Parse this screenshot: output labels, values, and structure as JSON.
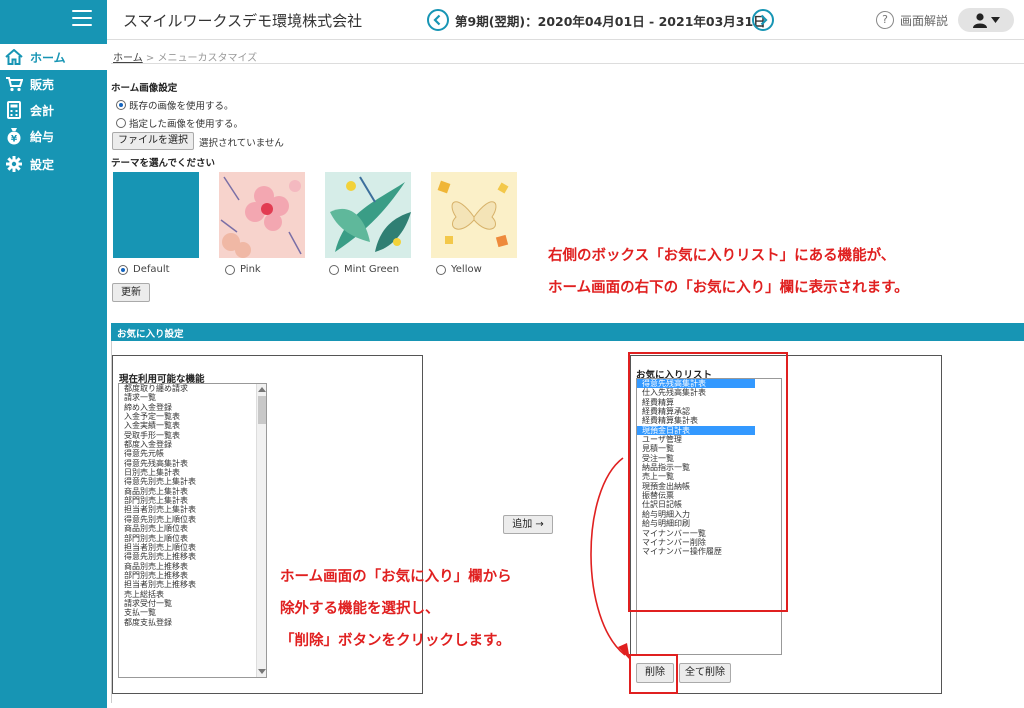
{
  "header": {
    "company": "スマイルワークスデモ環境株式会社",
    "period": "第9期(翌期)：2020年04月01日 - 2021年03月31日",
    "help_label": "画面解説"
  },
  "sidebar": {
    "items": [
      {
        "label": "ホーム",
        "icon": "home-icon"
      },
      {
        "label": "販売",
        "icon": "cart-icon"
      },
      {
        "label": "会計",
        "icon": "calculator-icon"
      },
      {
        "label": "給与",
        "icon": "money-bag-icon"
      },
      {
        "label": "設定",
        "icon": "gear-icon"
      }
    ]
  },
  "breadcrumb": {
    "home": "ホーム",
    "separator": ">",
    "current": "メニューカスタマイズ"
  },
  "home_image": {
    "heading": "ホーム画像設定",
    "option_default": "既存の画像を使用する。",
    "option_custom": "指定した画像を使用する。",
    "file_button": "ファイルを選択",
    "file_status": "選択されていません",
    "theme_heading": "テーマを選んでください",
    "themes": [
      "Default",
      "Pink",
      "Mint Green",
      "Yellow"
    ],
    "update_button": "更新"
  },
  "favorites": {
    "section_title": "お気に入り設定",
    "available_title": "現在利用可能な機能",
    "available_items": [
      "都度取り纏め請求",
      "請求一覧",
      "締め入金登録",
      "入金予定一覧表",
      "入金実績一覧表",
      "受取手形一覧表",
      "都度入金登録",
      "得意先元帳",
      "得意先残高集計表",
      "日別売上集計表",
      "得意先別売上集計表",
      "商品別売上集計表",
      "部門別売上集計表",
      "担当者別売上集計表",
      "得意先別売上順位表",
      "商品別売上順位表",
      "部門別売上順位表",
      "担当者別売上順位表",
      "得意先別売上推移表",
      "商品別売上推移表",
      "部門別売上推移表",
      "担当者別売上推移表",
      "売上総括表",
      "請求受付一覧",
      "支払一覧",
      "都度支払登録"
    ],
    "add_button": "追加 →",
    "list_title": "お気に入りリスト",
    "list_items": [
      "得意先残高集計表",
      "仕入先残高集計表",
      "経費精算",
      "経費精算承認",
      "経費精算集計表",
      "現預金日計表",
      "ユーザ管理",
      "見積一覧",
      "受注一覧",
      "納品指示一覧",
      "売上一覧",
      "現預金出納帳",
      "振替伝票",
      "仕訳日記帳",
      "給与明細入力",
      "給与明細印刷",
      "マイナンバー一覧",
      "マイナンバー削除",
      "マイナンバー操作履歴"
    ],
    "delete_button": "削除",
    "delete_all_button": "全て削除"
  },
  "annotations": {
    "note1_line1": "右側のボックス「お気に入りリスト」にある機能が、",
    "note1_line2": "ホーム画面の右下の「お気に入り」欄に表示されます。",
    "note2_line1": "ホーム画面の「お気に入り」欄から",
    "note2_line2": "除外する機能を選択し、",
    "note2_line3": "「削除」ボタンをクリックします。"
  },
  "colors": {
    "accent": "#1795b4",
    "annotation": "#e02020",
    "selection": "#3399ff"
  }
}
